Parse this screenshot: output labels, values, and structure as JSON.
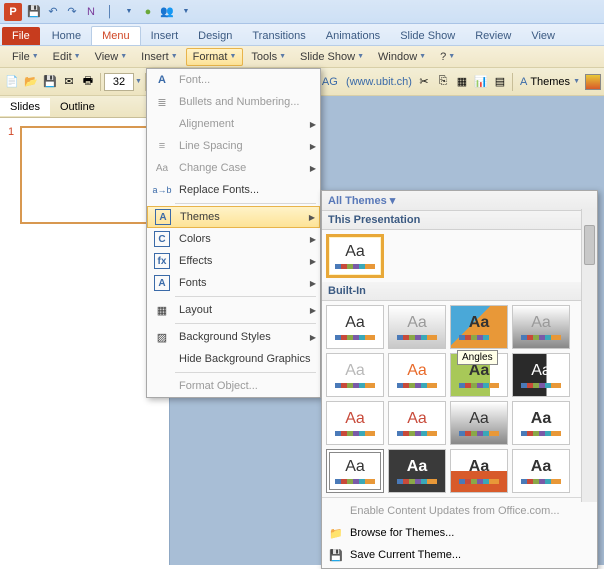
{
  "qat_icons": [
    "save",
    "undo",
    "redo",
    "onenote",
    "sep",
    "dd",
    "green",
    "people",
    "dd"
  ],
  "ribbon": {
    "file": "File",
    "tabs": [
      "Home",
      "Menu",
      "Insert",
      "Design",
      "Transitions",
      "Animations",
      "Slide Show",
      "Review",
      "View"
    ],
    "active": "Menu"
  },
  "menubar": [
    {
      "label": "File",
      "dd": true
    },
    {
      "label": "Edit",
      "dd": true
    },
    {
      "label": "View",
      "dd": true
    },
    {
      "label": "Insert",
      "dd": true
    },
    {
      "label": "Format",
      "dd": true,
      "hl": true
    },
    {
      "label": "Tools",
      "dd": true
    },
    {
      "label": "Slide Show",
      "dd": true
    },
    {
      "label": "Window",
      "dd": true
    },
    {
      "label": "?",
      "dd": true
    }
  ],
  "toolbar": {
    "fontsize": "32",
    "themes_label": "Themes"
  },
  "vendor": {
    "co": "iz AG",
    "url": "(www.ubit.ch)"
  },
  "slidepane": {
    "tabs": [
      "Slides",
      "Outline"
    ],
    "thumbnum": "1"
  },
  "format_menu": [
    {
      "icon": "A",
      "label": "Font...",
      "dim": true
    },
    {
      "icon": "list",
      "label": "Bullets and Numbering...",
      "dim": true
    },
    {
      "icon": "",
      "label": "Alignement",
      "sub": true,
      "dim": true
    },
    {
      "icon": "lines",
      "label": "Line Spacing",
      "sub": true,
      "dim": true
    },
    {
      "icon": "Aa",
      "label": "Change Case",
      "sub": true,
      "dim": true
    },
    {
      "icon": "ab",
      "label": "Replace Fonts..."
    },
    {
      "sep": true
    },
    {
      "icon": "A",
      "box": true,
      "label": "Themes",
      "sub": true,
      "sel": true
    },
    {
      "icon": "C",
      "box": true,
      "label": "Colors",
      "sub": true
    },
    {
      "icon": "fx",
      "box": true,
      "label": "Effects",
      "sub": true
    },
    {
      "icon": "A",
      "box": true,
      "label": "Fonts",
      "sub": true
    },
    {
      "sep": true
    },
    {
      "icon": "grid",
      "label": "Layout",
      "sub": true
    },
    {
      "sep": true
    },
    {
      "icon": "bg",
      "label": "Background Styles",
      "sub": true
    },
    {
      "icon": "",
      "label": "Hide Background Graphics"
    },
    {
      "sep": true
    },
    {
      "icon": "",
      "label": "Format Object...",
      "dim": true
    }
  ],
  "themes_flyout": {
    "all": "All Themes ▾",
    "section1": "This Presentation",
    "current": {
      "aa": "Aa"
    },
    "section2": "Built-In",
    "tooltip": "Angles",
    "grid": [
      {
        "aa": "Aa",
        "cls": ""
      },
      {
        "aa": "Aa",
        "cls": "grey",
        "dim": true
      },
      {
        "aa": "Aa",
        "cls": "grad",
        "bold": true,
        "tt": true
      },
      {
        "aa": "Aa",
        "cls": "gradient1",
        "dim": true
      },
      {
        "aa": "Aa",
        "cls": "",
        "dim": true,
        "gray": true
      },
      {
        "aa": "Aa",
        "cls": "",
        "orange": true
      },
      {
        "aa": "Aa",
        "cls": "green",
        "bold": true
      },
      {
        "aa": "Aa",
        "cls": "dk2",
        "white": true
      },
      {
        "aa": "Aa",
        "cls": "",
        "red": true
      },
      {
        "aa": "Aa",
        "cls": "",
        "red": true
      },
      {
        "aa": "Aa",
        "cls": "gradient1"
      },
      {
        "aa": "Aa",
        "cls": "",
        "bold": true
      },
      {
        "aa": "Aa",
        "cls": "frame"
      },
      {
        "aa": "Aa",
        "cls": "dark",
        "white": true,
        "bold": true
      },
      {
        "aa": "Aa",
        "cls": "orange2",
        "bold": true
      },
      {
        "aa": "Aa",
        "cls": "",
        "bold": true
      }
    ],
    "footer": [
      {
        "label": "Enable Content Updates from Office.com...",
        "dim": true,
        "icon": ""
      },
      {
        "label": "Browse for Themes...",
        "icon": "folder"
      },
      {
        "label": "Save Current Theme...",
        "icon": "save"
      }
    ]
  }
}
